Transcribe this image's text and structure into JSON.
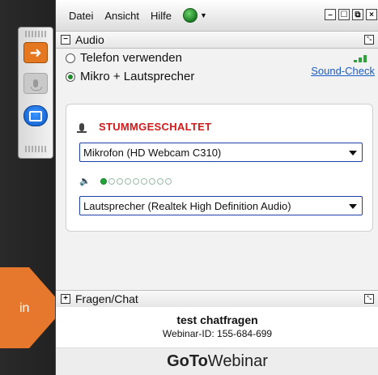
{
  "menu": {
    "items": [
      "Datei",
      "Ansicht",
      "Hilfe"
    ]
  },
  "window_buttons": {
    "minimize": "–",
    "restore": "☐",
    "popout": "⧉",
    "close": "×"
  },
  "audio": {
    "header": "Audio",
    "options": [
      {
        "label": "Telefon verwenden",
        "selected": false
      },
      {
        "label": "Mikro + Lautsprecher",
        "selected": true
      }
    ],
    "sound_check": "Sound-Check",
    "mute_status": "STUMMGESCHALTET",
    "microphone": "Mikrofon (HD Webcam C310)",
    "speaker": "Lautsprecher (Realtek High Definition Audio)",
    "speaker_level": {
      "lit": 1,
      "total": 9
    }
  },
  "chat": {
    "header": "Fragen/Chat",
    "webinar_title": "test chatfragen",
    "webinar_id": "Webinar-ID: 155-684-699"
  },
  "logo": {
    "bold": "GoTo",
    "light": "Webinar"
  },
  "overlay": {
    "text": "in"
  },
  "colors": {
    "accent": "#e4771f",
    "mute": "#d11a1a",
    "link": "#1a5cc8",
    "level_on": "#23a33a"
  }
}
